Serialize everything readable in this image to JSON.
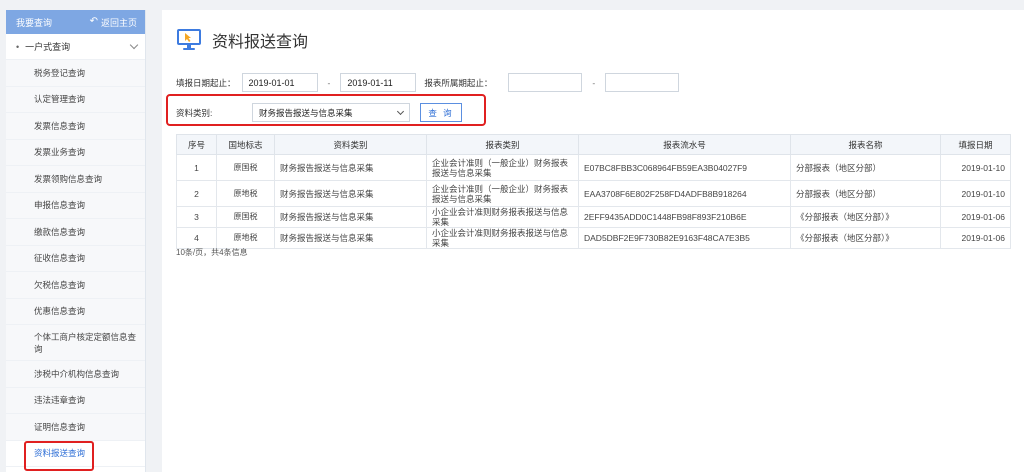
{
  "sidebar": {
    "header_title": "我要查询",
    "back_label": "返回主页",
    "group_label": "一户式查询",
    "items": [
      {
        "label": "税务登记查询"
      },
      {
        "label": "认定管理查询"
      },
      {
        "label": "发票信息查询"
      },
      {
        "label": "发票业务查询"
      },
      {
        "label": "发票领购信息查询"
      },
      {
        "label": "申报信息查询"
      },
      {
        "label": "缴款信息查询"
      },
      {
        "label": "征收信息查询"
      },
      {
        "label": "欠税信息查询"
      },
      {
        "label": "优惠信息查询"
      },
      {
        "label": "个体工商户核定定额信息查询"
      },
      {
        "label": "涉税中介机构信息查询"
      },
      {
        "label": "违法违章查询"
      },
      {
        "label": "证明信息查询"
      },
      {
        "label": "资料报送查询"
      }
    ]
  },
  "main": {
    "title": "资料报送查询",
    "form": {
      "fill_date_label": "填报日期起止：",
      "fill_date_start": "2019-01-01",
      "fill_date_end": "2019-01-11",
      "period_label": "报表所属期起止：",
      "period_start": "",
      "period_end": "",
      "dash": "-",
      "category_label": "资料类别:",
      "category_value": "财务报告报送与信息采集",
      "query_button": "查 询"
    },
    "table": {
      "headers": [
        "序号",
        "国地标志",
        "资料类别",
        "报表类别",
        "报表流水号",
        "报表名称",
        "填报日期"
      ],
      "rows": [
        {
          "no": "1",
          "flag": "原国税",
          "category": "财务报告报送与信息采集",
          "report_type": "企业会计准则（一般企业）财务报表报送与信息采集",
          "serial": "E07BC8FBB3C068964FB59EA3B04027F9",
          "name": "分部报表（地区分部）",
          "date": "2019-01-10"
        },
        {
          "no": "2",
          "flag": "原地税",
          "category": "财务报告报送与信息采集",
          "report_type": "企业会计准则（一般企业）财务报表报送与信息采集",
          "serial": "EAA3708F6E802F258FD4ADFB8B918264",
          "name": "分部报表（地区分部）",
          "date": "2019-01-10"
        },
        {
          "no": "3",
          "flag": "原国税",
          "category": "财务报告报送与信息采集",
          "report_type": "小企业会计准则财务报表报送与信息采集",
          "serial": "2EFF9435ADD0C1448FB98F893F210B6E",
          "name": "《分部报表（地区分部）》",
          "date": "2019-01-06"
        },
        {
          "no": "4",
          "flag": "原地税",
          "category": "财务报告报送与信息采集",
          "report_type": "小企业会计准则财务报表报送与信息采集",
          "serial": "DAD5DBF2E9F730B82E9163F48CA7E3B5",
          "name": "《分部报表（地区分部）》",
          "date": "2019-01-06"
        }
      ],
      "footer": "10条/页，共4条信息"
    }
  },
  "colors": {
    "sidebar_header": "#7ea7e3",
    "accent": "#2f6fd6",
    "highlight": "#e02020"
  }
}
